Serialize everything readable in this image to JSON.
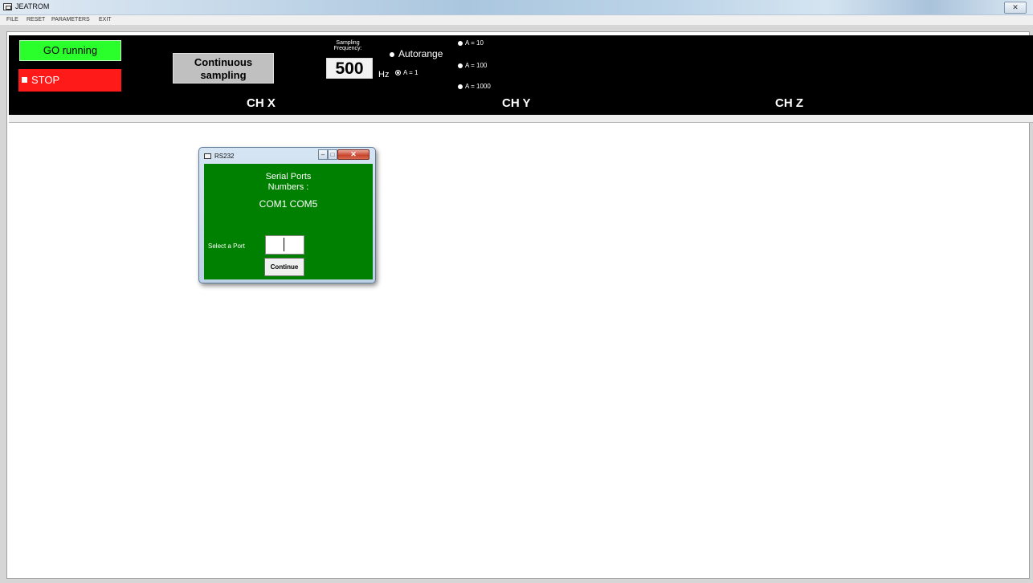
{
  "window": {
    "title": "JEATROM",
    "close_glyph": "✕"
  },
  "menu": [
    "FILE",
    "RESET",
    "PARAMETERS",
    "EXIT"
  ],
  "controls": {
    "go_label": "GO running",
    "stop_label": "STOP",
    "continuous_line1": "Continuous",
    "continuous_line2": "sampling",
    "sampling_label_line1": "Sampling",
    "sampling_label_line2": "Frequency:",
    "frequency_value": "500",
    "frequency_unit": "Hz",
    "autorange_label": "Autorange",
    "range_a1": "A = 1",
    "range_a10": "A = 10",
    "range_a100": "A = 100",
    "range_a1000": "A = 1000",
    "selected_range": "A = 1"
  },
  "channels": [
    "CH X",
    "CH Y",
    "CH Z"
  ],
  "dialog": {
    "title": "RS232",
    "heading_line1": "Serial Ports",
    "heading_line2": "Numbers :",
    "ports": "COM1 COM5",
    "select_label": "Select a Port",
    "port_value": "",
    "continue_label": "Continue"
  },
  "colors": {
    "go": "#2bff2b",
    "stop": "#ff1a1a",
    "panel": "#000000",
    "dialog_body": "#008000"
  }
}
